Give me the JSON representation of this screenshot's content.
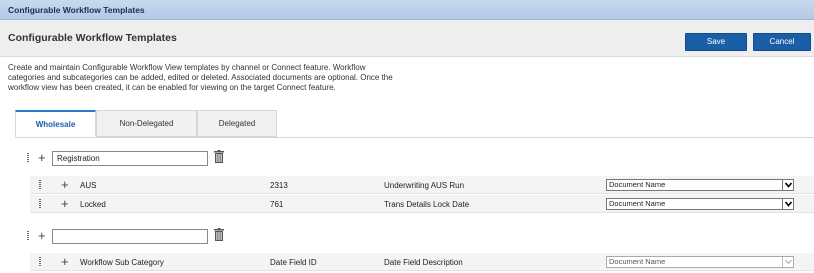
{
  "window": {
    "title": "Configurable Workflow Templates"
  },
  "header": {
    "title": "Configurable Workflow Templates",
    "save_label": "Save",
    "cancel_label": "Cancel"
  },
  "description": "Create and maintain Configurable Workflow View templates by channel or Connect feature. Workflow categories and subcategories can be added, edited or deleted. Associated documents are optional. Once the workflow view has been created, it can be enabled for viewing on the target Connect feature.",
  "tabs": [
    {
      "label": "Wholesale",
      "active": true
    },
    {
      "label": "Non-Delegated",
      "active": false
    },
    {
      "label": "Delegated",
      "active": false
    }
  ],
  "categories": [
    {
      "name": "Registration",
      "rows": [
        {
          "subcategory": "AUS",
          "field_id": "2313",
          "field_description": "Underwriting AUS Run",
          "document": "Document Name"
        },
        {
          "subcategory": "Locked",
          "field_id": "761",
          "field_description": "Trans Details Lock Date",
          "document": "Document Name"
        }
      ]
    },
    {
      "name": "",
      "rows": [
        {
          "subcategory": "Workflow Sub Category",
          "field_id": "Date Field ID",
          "field_description": "Date Field Description",
          "document": "Document Name"
        }
      ]
    }
  ],
  "colors": {
    "accent": "#1a5ea8",
    "titlebar": "#b4c9e6",
    "tab_active_border": "#2a78c6"
  }
}
